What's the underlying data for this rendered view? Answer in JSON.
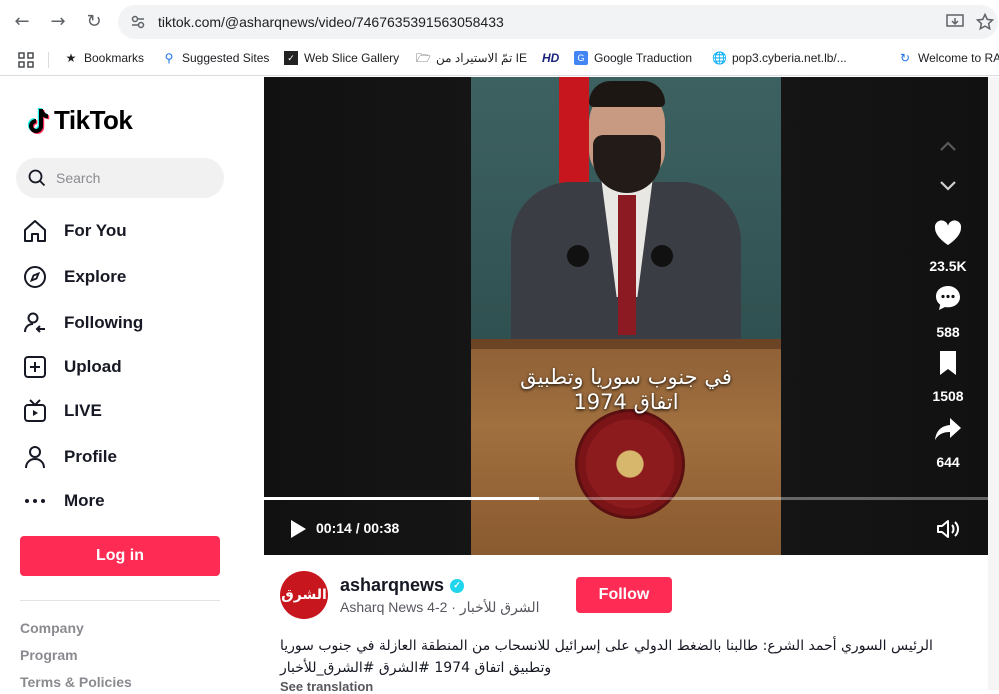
{
  "browser": {
    "url": "tiktok.com/@asharqnews/video/7467635391563058433",
    "bookmarks": [
      {
        "label": "Bookmarks",
        "icon": "star-icon"
      },
      {
        "label": "Suggested Sites",
        "icon": "search-icon"
      },
      {
        "label": "Web Slice Gallery",
        "icon": "web-slice-icon"
      },
      {
        "label": "تمّ الاستيراد من IE",
        "icon": "folder-icon"
      },
      {
        "label": "HD",
        "icon": "hd-icon"
      },
      {
        "label": "Google Traduction",
        "icon": "translate-icon"
      },
      {
        "label": "pop3.cyberia.net.lb/...",
        "icon": "globe-icon"
      },
      {
        "label": "Welcome to RA",
        "icon": "link-icon"
      }
    ]
  },
  "sidebar": {
    "logo": "TikTok",
    "search_placeholder": "Search",
    "nav": [
      {
        "label": "For You",
        "icon": "home-icon"
      },
      {
        "label": "Explore",
        "icon": "compass-icon"
      },
      {
        "label": "Following",
        "icon": "following-icon"
      },
      {
        "label": "Upload",
        "icon": "upload-icon"
      },
      {
        "label": "LIVE",
        "icon": "live-tv-icon"
      },
      {
        "label": "Profile",
        "icon": "profile-icon"
      },
      {
        "label": "More",
        "icon": "more-dots-icon"
      }
    ],
    "login_label": "Log in",
    "footer": [
      "Company",
      "Program",
      "Terms & Policies"
    ]
  },
  "video": {
    "caption_line1": "في جنوب سوريا وتطبيق",
    "caption_line2": "اتفاق 1974",
    "time": "00:14 / 00:38",
    "progress": 0.38,
    "actions": {
      "likes": "23.5K",
      "comments": "588",
      "saves": "1508",
      "shares": "644"
    }
  },
  "post": {
    "avatar_text": "الشرق",
    "username": "asharqnews",
    "display_line": "Asharq News الشرق للأخبار · 2-4",
    "follow_label": "Follow",
    "description": "الرئيس السوري أحمد الشرع: طالبنا بالضغط الدولي على إسرائيل للانسحاب من المنطقة العازلة في جنوب سوريا وتطبيق اتفاق 1974 #الشرق #الشرق_للأخبار",
    "see_translation": "See translation"
  },
  "colors": {
    "brand": "#fe2c55",
    "verified": "#20d5ec"
  }
}
